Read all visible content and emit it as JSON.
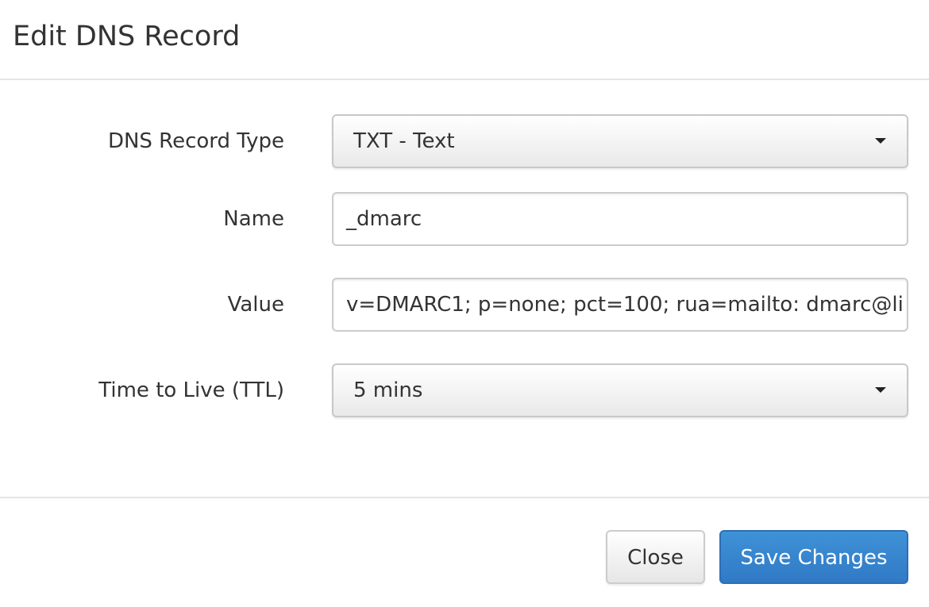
{
  "dialog": {
    "title": "Edit DNS Record"
  },
  "form": {
    "record_type": {
      "label": "DNS Record Type",
      "selected": "TXT - Text"
    },
    "name": {
      "label": "Name",
      "value": "_dmarc"
    },
    "value": {
      "label": "Value",
      "value": "v=DMARC1; p=none; pct=100; rua=mailto: dmarc@li"
    },
    "ttl": {
      "label": "Time to Live (TTL)",
      "selected": "5 mins"
    }
  },
  "footer": {
    "close_label": "Close",
    "save_label": "Save Changes"
  },
  "colors": {
    "primary": "#337ab7",
    "border": "#cccccc",
    "text": "#333333"
  },
  "icons": {
    "dropdown": "caret-down-icon"
  }
}
